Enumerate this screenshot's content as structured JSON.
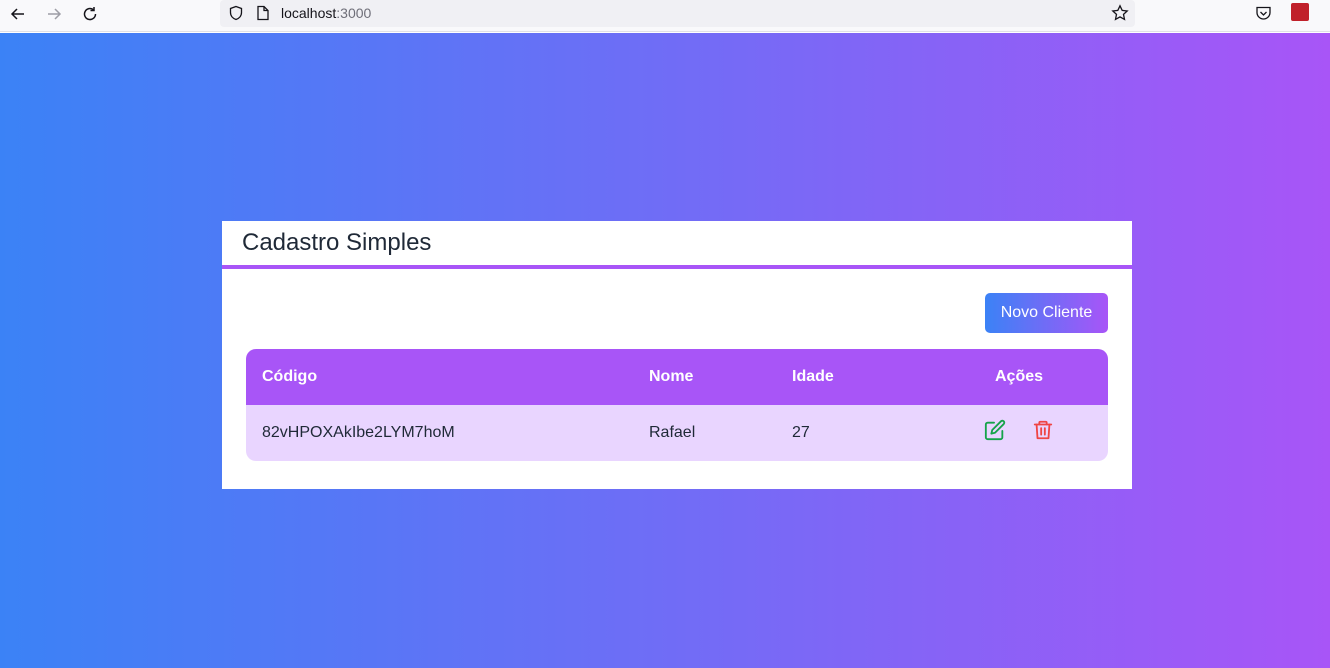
{
  "browser": {
    "url_host": "localhost",
    "url_port": ":3000"
  },
  "card": {
    "title": "Cadastro Simples",
    "new_button_label": "Novo Cliente"
  },
  "table": {
    "headers": [
      "Código",
      "Nome",
      "Idade",
      "Ações"
    ],
    "rows": [
      {
        "codigo": "82vHPOXAkIbe2LYM7hoM",
        "nome": "Rafael",
        "idade": "27"
      }
    ]
  },
  "colors": {
    "gradient_start": "#3b82f6",
    "gradient_end": "#a855f7",
    "accent": "#a855f7",
    "row_bg": "#e9d5ff",
    "edit_icon": "#16a34a",
    "delete_icon": "#ef4444"
  },
  "icons": {
    "edit": "edit-icon",
    "delete": "trash-icon"
  }
}
